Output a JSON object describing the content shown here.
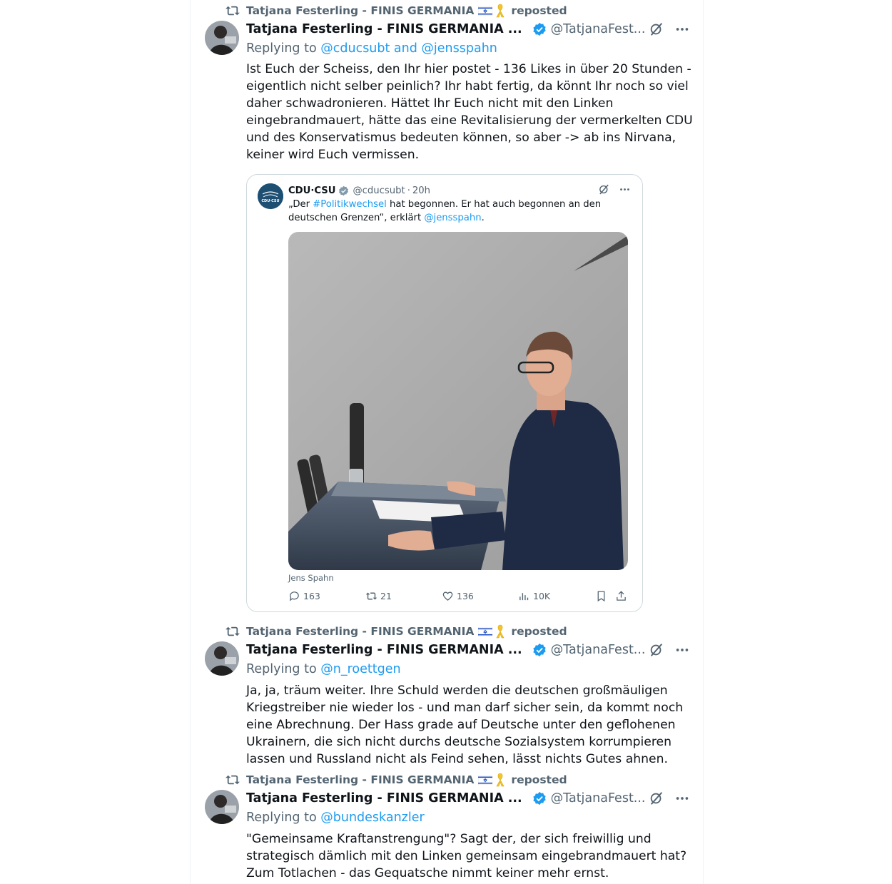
{
  "colors": {
    "link": "#1d9bf0",
    "secondary": "#536471",
    "verified": "#1d9bf0"
  },
  "posts": [
    {
      "repost_author": "Tatjana Festerling - FINIS GERMANIA",
      "repost_label": "reposted",
      "author_name": "Tatjana Festerling - FINIS GERMANIA ...",
      "handle": "@TatjanaFest...",
      "replying_prefix": "Replying to",
      "replying_to": "@cducsubt and @jensspahn",
      "text": "Ist Euch der Scheiss, den Ihr hier postet - 136 Likes in über 20 Stunden - eigentlich nicht selber peinlich? Ihr habt fertig, da könnt Ihr noch so viel daher schwadronieren. Hättet Ihr Euch nicht mit den Linken eingebrandmauert, hätte das eine Revitalisierung der vermerkelten CDU und des Konservatismus bedeuten können, so aber -> ab ins Nirvana, keiner wird Euch vermissen."
    },
    {
      "repost_author": "Tatjana Festerling - FINIS GERMANIA",
      "repost_label": "reposted",
      "author_name": "Tatjana Festerling - FINIS GERMANIA ...",
      "handle": "@TatjanaFest...",
      "replying_prefix": "Replying to",
      "replying_to": "@n_roettgen",
      "text": "Ja, ja, träum weiter. Ihre Schuld werden die deutschen großmäuligen Kriegstreiber nie wieder los - und man darf sicher sein, da kommt noch eine Abrechnung. Der Hass grade auf Deutsche unter den geflohenen Ukrainern, die sich nicht durchs deutsche Sozialsystem korrumpieren lassen und Russland nicht als Feind sehen, lässt nichts Gutes ahnen."
    },
    {
      "repost_author": "Tatjana Festerling - FINIS GERMANIA",
      "repost_label": "reposted",
      "author_name": "Tatjana Festerling - FINIS GERMANIA ...",
      "handle": "@TatjanaFest...",
      "replying_prefix": "Replying to",
      "replying_to": "@bundeskanzler",
      "text": "\"Gemeinsame Kraftanstrengung\"? Sagt der, der sich freiwillig und strategisch dämlich mit den Linken gemeinsam eingebrandmauert hat? Zum Totlachen - das Gequatsche nimmt keiner mehr ernst."
    }
  ],
  "quote": {
    "name": "CDU·CSU",
    "handle": "@cducsubt",
    "dot": "·",
    "time": "20h",
    "text_before": "„Der ",
    "hashtag": "#Politikwechsel",
    "text_middle": " hat begonnen. Er hat auch begonnen an den deutschen Grenzen“, erklärt ",
    "mention": "@jensspahn",
    "text_after": ".",
    "avatar_text": "CDU·CSU",
    "caption": "Jens Spahn",
    "metrics": {
      "replies": "163",
      "reposts": "21",
      "likes": "136",
      "views": "10K"
    }
  },
  "icons": [
    "repost-icon",
    "israel-flag-icon",
    "yellow-ribbon-icon",
    "verified-badge-icon",
    "grok-icon",
    "more-icon",
    "reply-icon",
    "like-icon",
    "views-icon",
    "bookmark-icon",
    "share-icon"
  ]
}
